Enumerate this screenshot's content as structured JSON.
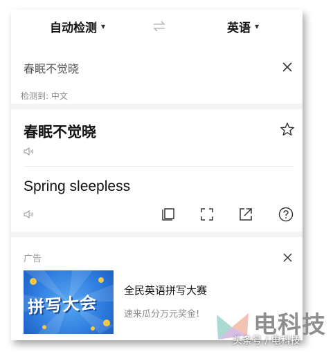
{
  "header": {
    "source_lang": "自动检测",
    "target_lang": "英语"
  },
  "input": {
    "text": "春眠不觉晓",
    "detected_label": "检测到: 中文"
  },
  "result": {
    "source": "春眠不觉晓",
    "translation": "Spring sleepless"
  },
  "ad": {
    "label": "广告",
    "image_text": "拼写大会",
    "title": "全民英语拼写大赛",
    "subtitle": "速来瓜分万元奖金!"
  },
  "watermark": {
    "name": "电科技",
    "source": "头条号 / 电科技"
  },
  "colors": {
    "background": "#f4f4f6",
    "card": "#ffffff",
    "text_primary": "#111111",
    "text_secondary": "#8a8a8a",
    "icon": "#333333",
    "ad_blue": "#2f7ee0"
  }
}
